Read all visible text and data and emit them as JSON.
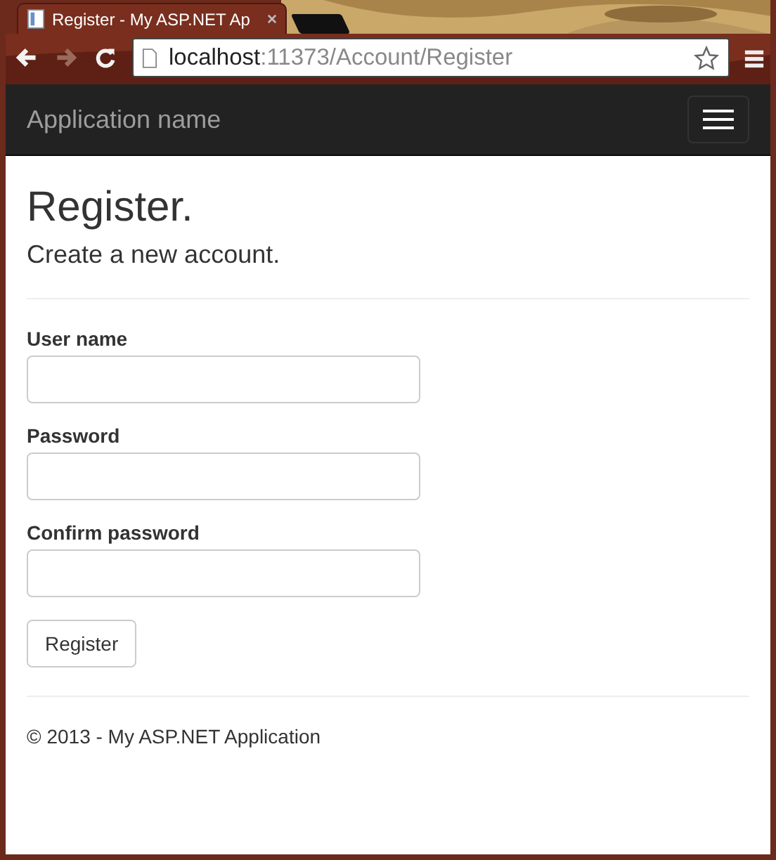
{
  "browser": {
    "tab_title": "Register - My ASP.NET Ap",
    "address_host": "localhost",
    "address_path": ":11373/Account/Register",
    "back_disabled": false,
    "forward_disabled": true
  },
  "navbar": {
    "brand": "Application name"
  },
  "page": {
    "title": "Register.",
    "subtitle": "Create a new account."
  },
  "fields": [
    {
      "label": "User name"
    },
    {
      "label": "Password"
    },
    {
      "label": "Confirm password"
    }
  ],
  "submit": "Register",
  "footer": "© 2013 - My ASP.NET Application"
}
